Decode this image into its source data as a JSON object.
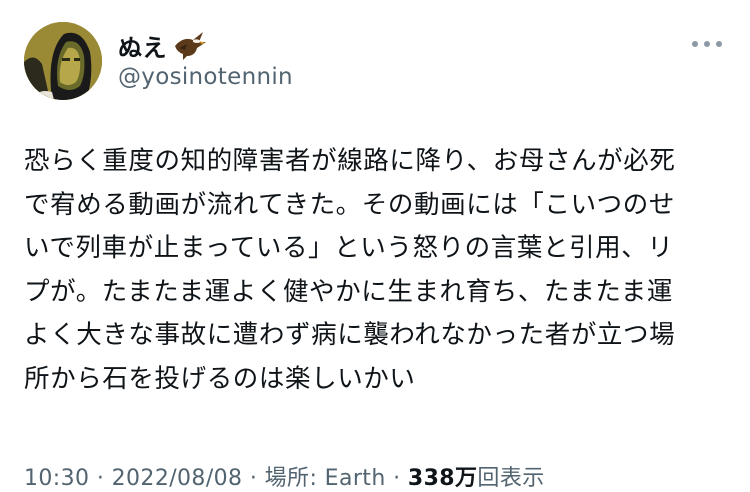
{
  "author": {
    "display_name": "ぬえ",
    "emoji": "eagle-emoji",
    "handle": "@yosinotennin",
    "avatar": "masked-face-avatar"
  },
  "menu": {
    "icon": "more-horizontal-icon"
  },
  "tweet": {
    "lines": [
      "恐らく重度の知的障害者が線路に降り、お母さんが必死",
      "で宥める動画が流れてきた。その動画には「こいつのせ",
      "いで列車が止まっている」という怒りの言葉と引用、リ",
      "プが。たまたま運よく健やかに生まれ育ち、たまたま運",
      "よく大きな事故に遭わず病に襲われなかった者が立つ場",
      "所から石を投げるのは楽しいかい"
    ]
  },
  "meta": {
    "time": "10:30",
    "separator": "·",
    "date": "2022/08/08",
    "location": "場所: Earth",
    "views_count": "338万",
    "views_label": "回表示"
  },
  "colors": {
    "text": "#0f1419",
    "secondary": "#536471",
    "background": "#ffffff"
  }
}
